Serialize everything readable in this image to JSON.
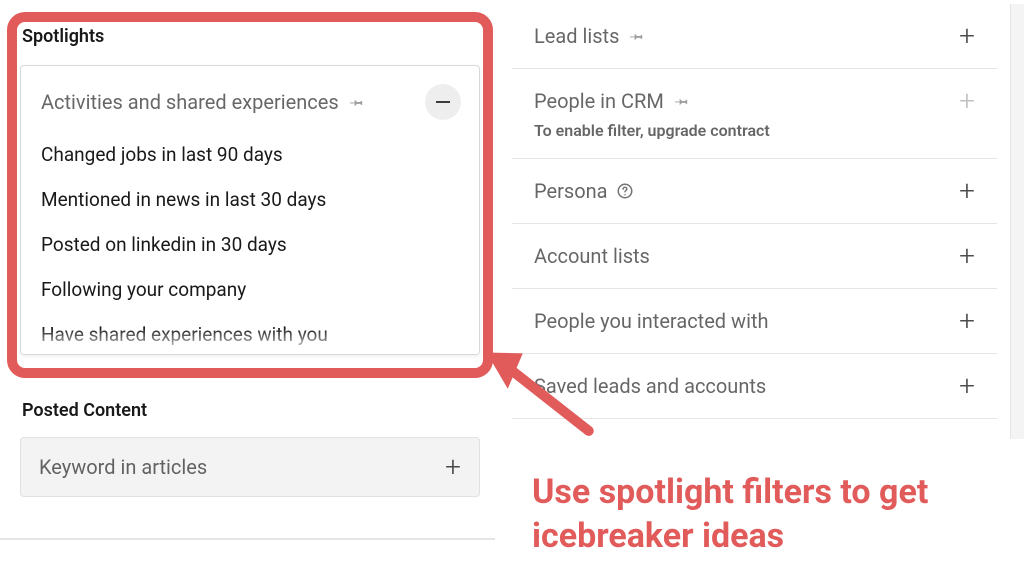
{
  "colors": {
    "annotation_red": "#e25b5b"
  },
  "left": {
    "spotlights": {
      "title": "Spotlights",
      "panel_title": "Activities and shared experiences",
      "options": [
        "Changed jobs in last 90 days",
        "Mentioned in news in last 30 days",
        "Posted on linkedin in 30 days",
        "Following your company",
        "Have shared experiences with you"
      ]
    },
    "posted": {
      "title": "Posted Content",
      "filter_label": "Keyword in articles"
    }
  },
  "right": {
    "rows": [
      {
        "label": "Lead lists",
        "pinned": true,
        "disabled": false,
        "sublabel": ""
      },
      {
        "label": "People in CRM",
        "pinned": true,
        "disabled": true,
        "sublabel": "To enable filter, upgrade contract"
      },
      {
        "label": "Persona",
        "help": true,
        "disabled": false,
        "sublabel": ""
      },
      {
        "label": "Account lists",
        "disabled": false,
        "sublabel": ""
      },
      {
        "label": "People you interacted with",
        "disabled": false,
        "sublabel": ""
      },
      {
        "label": "Saved leads and accounts",
        "disabled": false,
        "sublabel": ""
      }
    ]
  },
  "annotation": "Use spotlight filters to get icebreaker ideas",
  "icons": {
    "pin": "pin-icon",
    "collapse": "minus-icon",
    "expand": "plus-icon",
    "help": "help-circle-icon"
  }
}
